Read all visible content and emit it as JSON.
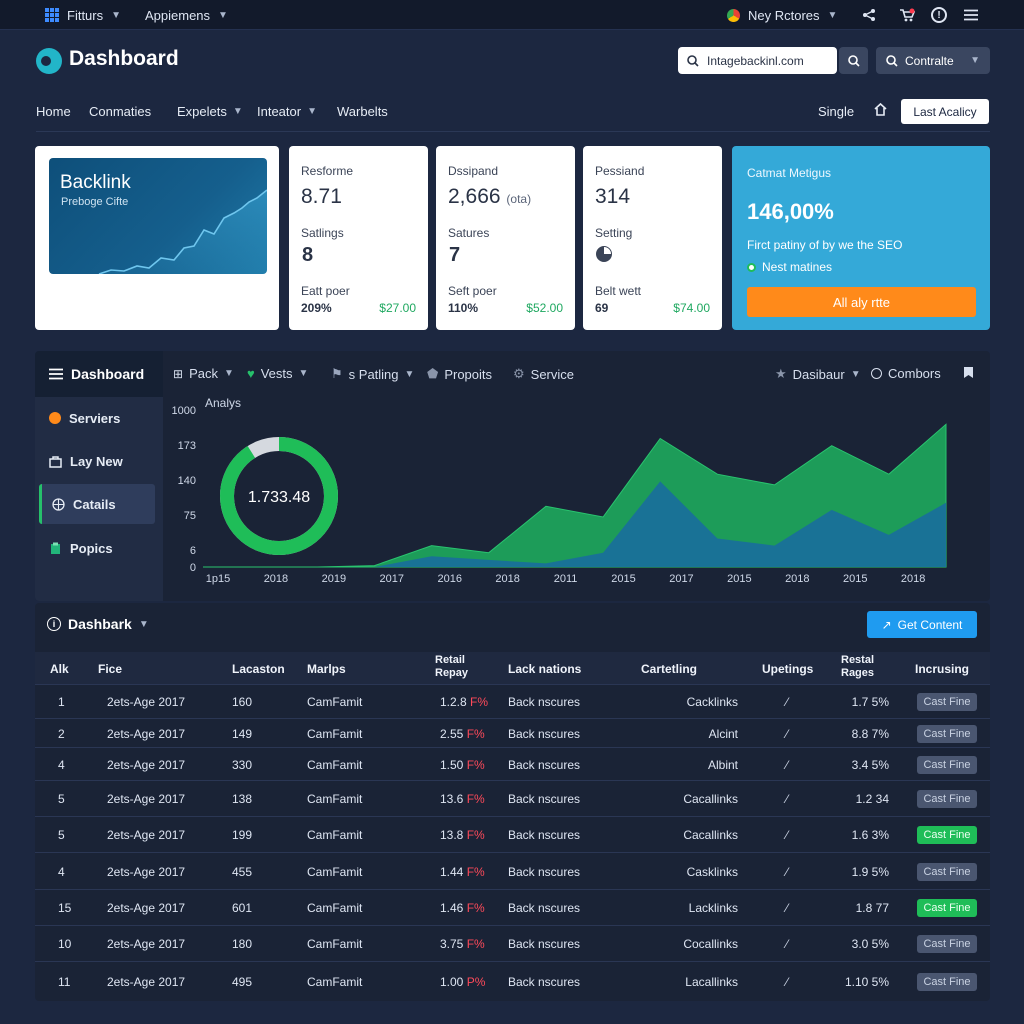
{
  "appbar": {
    "left_items": [
      "Fitturs",
      "Appiemens"
    ],
    "right_label": "Ney Rctores"
  },
  "header": {
    "brand": "Dashboard",
    "search_value": "Intagebackinl.com",
    "controls_label": "Contralte"
  },
  "nav": {
    "links": [
      "Home",
      "Conmaties",
      "Expelets",
      "Inteator",
      "Warbelts"
    ],
    "single_label": "Single",
    "last_button": "Last Acalicy"
  },
  "hero_card": {
    "title": "Backlink",
    "subtitle": "Preboge Cifte"
  },
  "stat_cards": [
    {
      "title": "Resforme",
      "value": "8.71",
      "label2": "Satlings",
      "value2": "8",
      "label3": "Eatt poer",
      "pct": "209%",
      "money": "$27.00"
    },
    {
      "title": "Dssipand",
      "value": "2,666",
      "unit": "(ota)",
      "label2": "Satures",
      "value2": "7",
      "label3": "Seft poer",
      "pct": "110%",
      "money": "$52.00"
    },
    {
      "title": "Pessiand",
      "value": "314",
      "label2": "Setting",
      "value2": "",
      "label3": "Belt wett",
      "pct": "69",
      "money": "$74.00"
    }
  ],
  "blue_card": {
    "title": "Catmat Metigus",
    "value": "146,00%",
    "desc": "Firct patiny of by we the SEO",
    "status": "Nest matines",
    "button": "All aly rtte"
  },
  "sidebar": {
    "head": "Dashboard",
    "items": [
      "Serviers",
      "Lay New",
      "Catails",
      "Popics"
    ],
    "active_index": 2
  },
  "tabs": {
    "left": [
      "Pack",
      "Vests",
      "s Patling",
      "Propoits",
      "Service"
    ],
    "right": [
      "Dasibaur",
      "Combors"
    ]
  },
  "chart_data": {
    "type": "area",
    "title": "Analys",
    "donut_value": "1.733.48",
    "donut_fraction": 0.91,
    "y_ticks": [
      "1000",
      "173",
      "140",
      "75",
      "6",
      "0"
    ],
    "x_ticks": [
      "1p15",
      "2018",
      "2019",
      "2017",
      "2016",
      "2018",
      "2011",
      "2015",
      "2017",
      "2015",
      "2018",
      "2015",
      "2018"
    ],
    "series": [
      {
        "color": "#1ea35c",
        "values": [
          0,
          0,
          0,
          2,
          30,
          20,
          85,
          70,
          180,
          130,
          115,
          170,
          130,
          200
        ]
      },
      {
        "color": "#1a6e9c",
        "values": [
          0,
          0,
          0,
          0,
          15,
          10,
          5,
          20,
          120,
          40,
          30,
          80,
          45,
          90
        ]
      }
    ]
  },
  "table": {
    "title": "Dashbark",
    "button": "Get Content",
    "columns": [
      "Alk",
      "Fice",
      "Lacaston",
      "Marlps",
      "Retail Repay",
      "Lack nations",
      "Cartetling",
      "Upetings",
      "Restal Rages",
      "Incrusing"
    ],
    "rows": [
      {
        "n": "1",
        "date": "2ets-Age 2017",
        "loc": "160",
        "mark": "CamFamit",
        "num": "1.2.8",
        "pct": "F%",
        "lack": "Back nscures",
        "cart": "Cacklinks",
        "rages": "1.7 5%",
        "status": "Cast Fine",
        "green": false
      },
      {
        "n": "2",
        "date": "2ets-Age 2017",
        "loc": "149",
        "mark": "CamFamit",
        "num": "2.55",
        "pct": "F%",
        "lack": "Back nscures",
        "cart": "Alcint",
        "rages": "8.8 7%",
        "status": "Cast Fine",
        "green": false
      },
      {
        "n": "4",
        "date": "2ets-Age 2017",
        "loc": "330",
        "mark": "CamFamit",
        "num": "1.50",
        "pct": "F%",
        "lack": "Back nscures",
        "cart": "Albint",
        "rages": "3.4 5%",
        "status": "Cast Fine",
        "green": false
      },
      {
        "n": "5",
        "date": "2ets-Age 2017",
        "loc": "138",
        "mark": "CamFamit",
        "num": "13.6",
        "pct": "F%",
        "lack": "Back nscures",
        "cart": "Cacallinks",
        "rages": "1.2 34",
        "status": "Cast Fine",
        "green": false
      },
      {
        "n": "5",
        "date": "2ets-Age 2017",
        "loc": "199",
        "mark": "CamFamit",
        "num": "13.8",
        "pct": "F%",
        "lack": "Back nscures",
        "cart": "Cacallinks",
        "rages": "1.6 3%",
        "status": "Cast Fine",
        "green": true
      },
      {
        "n": "4",
        "date": "2ets-Age 2017",
        "loc": "455",
        "mark": "CamFamit",
        "num": "1.44",
        "pct": "F%",
        "lack": "Back nscures",
        "cart": "Casklinks",
        "rages": "1.9 5%",
        "status": "Cast Fine",
        "green": false
      },
      {
        "n": "15",
        "date": "2ets-Age 2017",
        "loc": "601",
        "mark": "CamFamit",
        "num": "1.46",
        "pct": "F%",
        "lack": "Back nscures",
        "cart": "Lacklinks",
        "rages": "1.8 77",
        "status": "Cast Fine",
        "green": true
      },
      {
        "n": "10",
        "date": "2ets-Age 2017",
        "loc": "180",
        "mark": "CamFamit",
        "num": "3.75",
        "pct": "F%",
        "lack": "Back nscures",
        "cart": "Cocallinks",
        "rages": "3.0 5%",
        "status": "Cast Fine",
        "green": false
      },
      {
        "n": "11",
        "date": "2ets-Age 2017",
        "loc": "495",
        "mark": "CamFamit",
        "num": "1.00",
        "pct": "P%",
        "lack": "Back nscures",
        "cart": "Lacallinks",
        "rages": "1.10 5%",
        "status": "Cast Fine",
        "green": false
      }
    ]
  }
}
